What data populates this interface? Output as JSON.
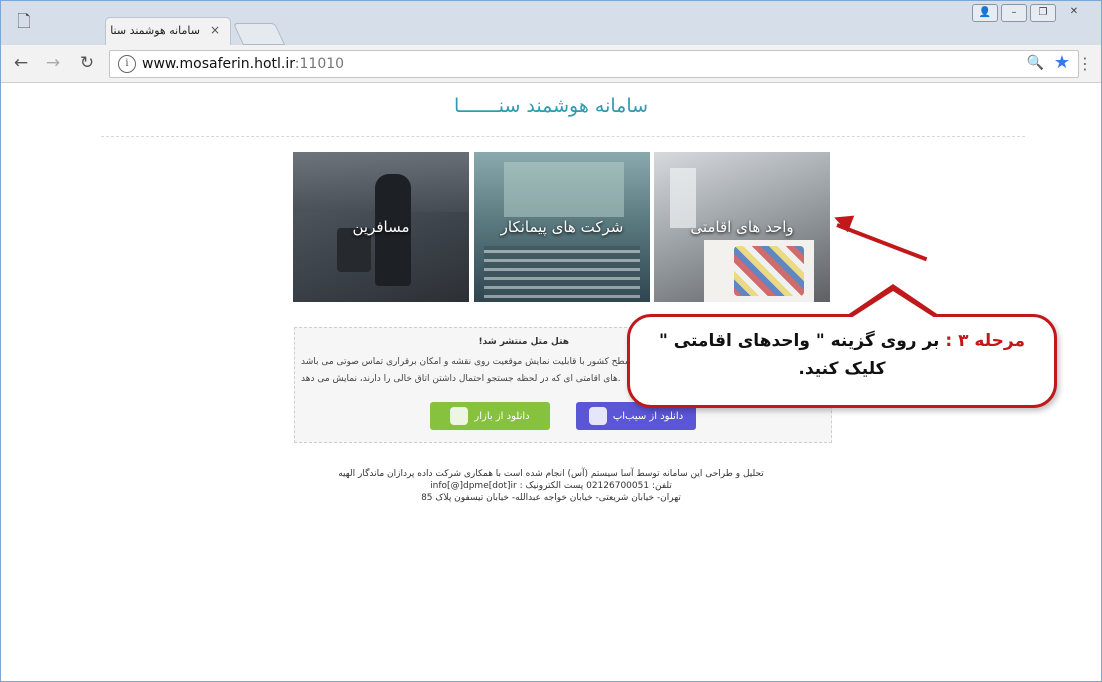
{
  "browser": {
    "tab_title": "سامانه هوشمند سنا",
    "tab_close": "×",
    "url_host": "www.mosaferin.hotl.ir",
    "url_port": ":11010",
    "info_glyph": "i",
    "icons": [
      "new-page-icon",
      "back-icon",
      "forward-icon",
      "reload-icon",
      "info-icon",
      "zoom-icon",
      "star-icon",
      "menu-icon",
      "user-icon",
      "minimize-icon",
      "restore-icon",
      "close-icon"
    ]
  },
  "page": {
    "brand": "سامانه هوشمند سنـــــــا",
    "tiles": [
      {
        "label": "واحد های اقامتی"
      },
      {
        "label": "شرکت های پیمانکار"
      },
      {
        "label": "مسافرین"
      }
    ],
    "info": {
      "headline": "هتل متل منتشر شد!",
      "line1": "سطح کشور با قابلیت نمایش موقعیت روی نقشه و امکان برقراری تماس صوتی می باشد.",
      "line2": "های اقامتی ای که در لحظه جستجو احتمال داشتن اتاق خالی را دارند، نمایش می دهد.",
      "sibapp_label": "دانلود از سیب‌اپ",
      "bazaar_label": "دانلود از بازار"
    },
    "footer": {
      "line1": "تحلیل و طراحی این سامانه توسط آسا سیستم (آس) انجام شده است با همکاری شرکت داده پردازان ماندگار الهیه",
      "line2": "تلفن: 02126700051 پست الکترونیک : info[@]dpme[dot]ir",
      "line3": "تهران- خیابان شریعتی- خیابان خواجه عبدالله- خیابان تیسفون پلاک 85"
    }
  },
  "annotation": {
    "step": "مرحله ۳ :",
    "text1": " بر روی گزینه \" واحدهای اقامتی \"",
    "text2": "کلیک کنید.",
    "color": "#c0181b"
  }
}
